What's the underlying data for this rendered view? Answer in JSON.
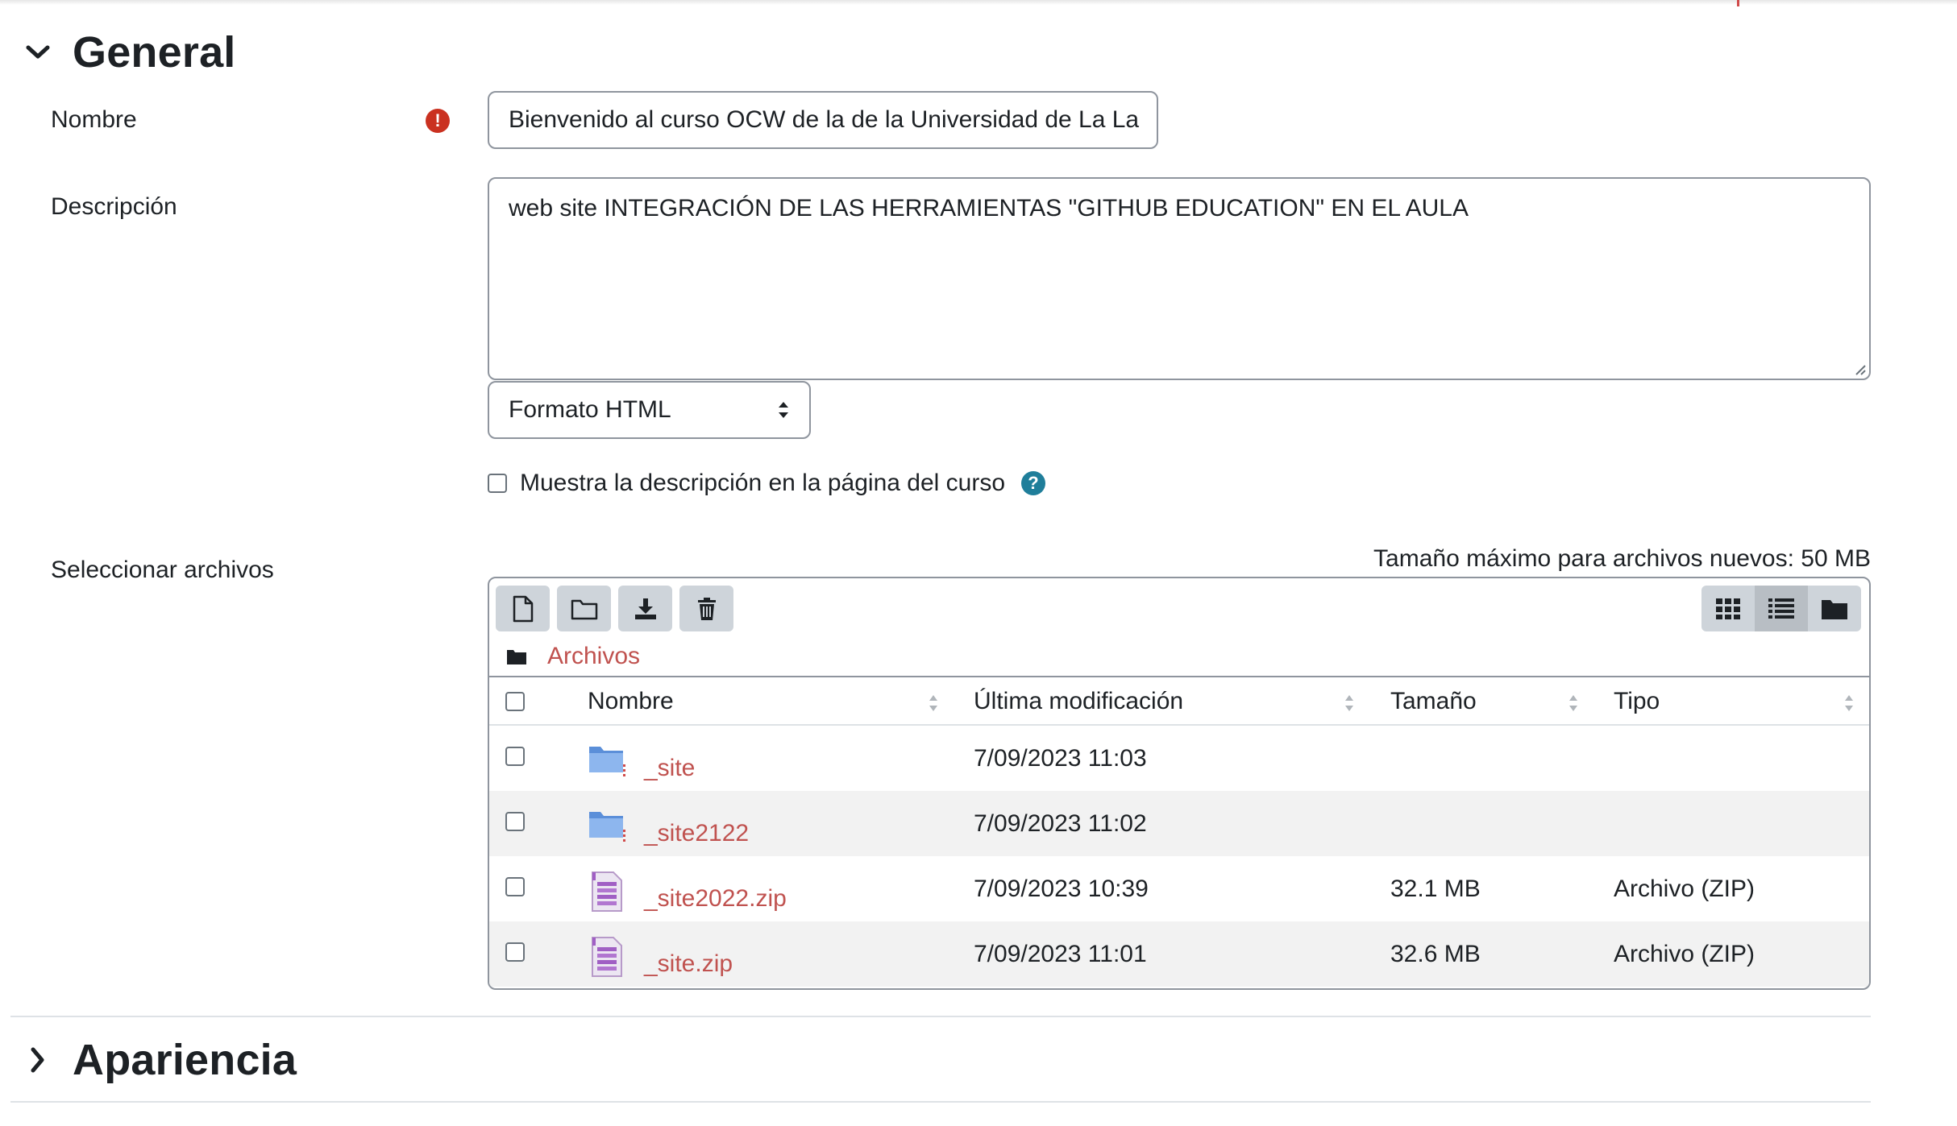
{
  "general": {
    "title": "General",
    "nombre_label": "Nombre",
    "nombre_value": "Bienvenido al curso OCW de la de la Universidad de La La",
    "required_icon": "exclamation-circle-icon",
    "descripcion_label": "Descripción",
    "descripcion_value": "web site INTEGRACIÓN DE LAS HERRAMIENTAS \"GITHUB EDUCATION\" EN EL AULA",
    "format_selected": "Formato HTML",
    "show_description_label": "Muestra la descripción en la página del curso",
    "show_description_checked": false,
    "files_label": "Seleccionar archivos",
    "max_size_text": "Tamaño máximo para archivos nuevos: 50 MB"
  },
  "filemanager": {
    "toolbar": [
      "new-file-icon",
      "new-folder-icon",
      "download-icon",
      "trash-icon"
    ],
    "views": [
      "grid-view-icon",
      "list-view-icon",
      "folder-tree-icon"
    ],
    "active_view": "list-view-icon",
    "breadcrumb": "Archivos",
    "columns": {
      "name": "Nombre",
      "modified": "Última modificación",
      "size": "Tamaño",
      "type": "Tipo"
    },
    "rows": [
      {
        "name": "_site",
        "date": "7/09/2023 11:03",
        "size": "",
        "type": "",
        "kind": "folder"
      },
      {
        "name": "_site2122",
        "date": "7/09/2023 11:02",
        "size": "",
        "type": "",
        "kind": "folder"
      },
      {
        "name": "_site2022.zip",
        "date": "7/09/2023 10:39",
        "size": "32.1 MB",
        "type": "Archivo (ZIP)",
        "kind": "zip"
      },
      {
        "name": "_site.zip",
        "date": "7/09/2023 11:01",
        "size": "32.6 MB",
        "type": "Archivo (ZIP)",
        "kind": "zip"
      }
    ]
  },
  "apariencia": {
    "title": "Apariencia"
  },
  "colors": {
    "link": "#c0524f",
    "required": "#ca3120",
    "help": "#1f7e9a",
    "button": "#ced4da"
  }
}
